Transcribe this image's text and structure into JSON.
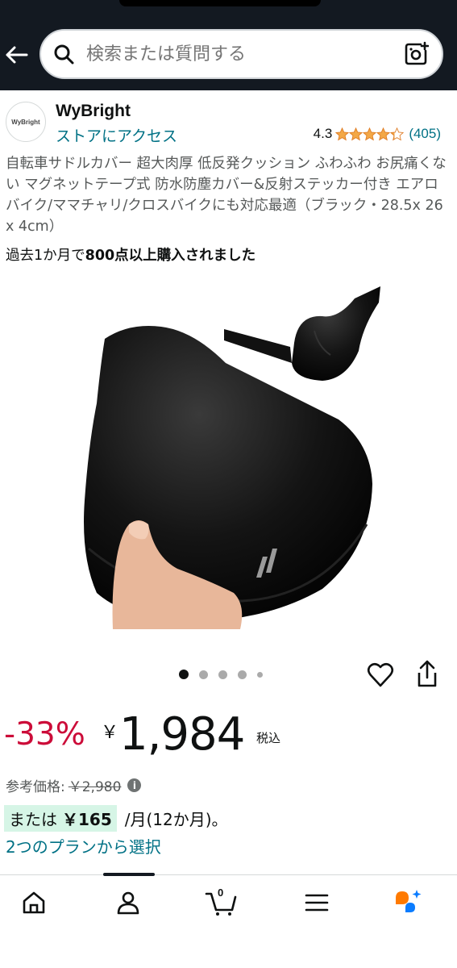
{
  "header": {
    "search_placeholder": "検索または質問する"
  },
  "brand": {
    "logo_text": "WyBright",
    "name": "WyBright",
    "store_link": "ストアにアクセス",
    "rating": "4.3",
    "rating_count": "(405)",
    "star_fill": 4.3
  },
  "product": {
    "title": "自転車サドルカバー 超大肉厚 低反発クッション ふわふわ お尻痛くない マグネットテープ式 防水防塵カバー&反射ステッカー付き エアロバイク/ママチャリ/クロスバイクにも対応最適（ブラック・28.5x 26 x 4cm）",
    "purchase_prefix": "過去1か月で",
    "purchase_bold": "800点以上購入されました"
  },
  "carousel": {
    "total_dots": 5,
    "active_index": 0
  },
  "price": {
    "discount": "-33%",
    "currency": "￥",
    "value": "1,984",
    "tax": "税込",
    "ref_label": "参考価格:",
    "ref_value": "￥2,980",
    "info_symbol": "i"
  },
  "installment": {
    "prefix": "または",
    "amount": "￥165",
    "term": "/月(12か月)。",
    "plans_link": "2つのプランから選択"
  },
  "bottom_nav": {
    "cart_count": "0",
    "items": [
      "home-icon",
      "account-icon",
      "cart-icon",
      "menu-icon",
      "rufus-ai-icon"
    ]
  },
  "colors": {
    "header_bg": "#131921",
    "link": "#007185",
    "discount": "#cc0c39",
    "star": "#f3a847",
    "installment_badge": "#d6f5e6",
    "rufus_orange": "#ff7a00",
    "rufus_blue": "#0a7cff"
  }
}
